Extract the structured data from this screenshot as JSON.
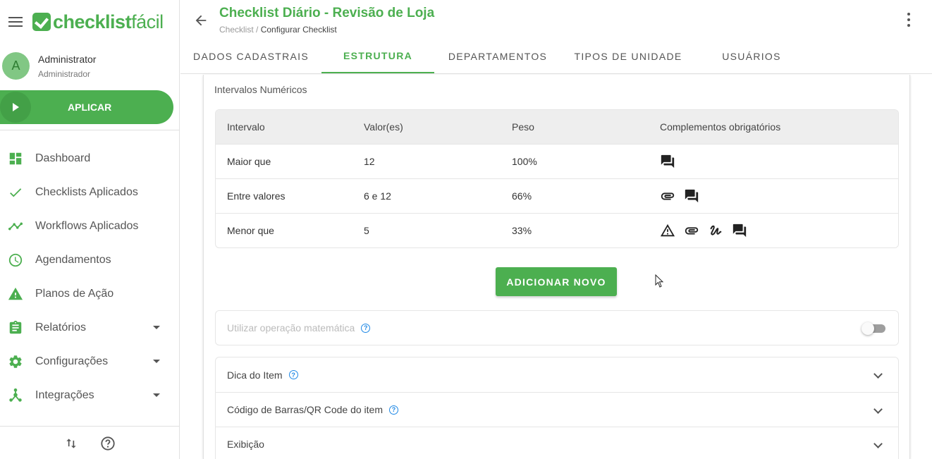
{
  "brand": {
    "logo_bold": "checklist",
    "logo_light": "fácil",
    "color": "#4caf50"
  },
  "user": {
    "initial": "A",
    "name": "Administrator",
    "role": "Administrador"
  },
  "apply_label": "APLICAR",
  "nav": [
    {
      "label": "Dashboard",
      "icon": "dashboard-icon"
    },
    {
      "label": "Checklists Aplicados",
      "icon": "check-icon"
    },
    {
      "label": "Workflows Aplicados",
      "icon": "trending-icon"
    },
    {
      "label": "Agendamentos",
      "icon": "clock-icon"
    },
    {
      "label": "Planos de Ação",
      "icon": "warning-icon"
    },
    {
      "label": "Relatórios",
      "icon": "clipboard-icon",
      "has_submenu": true
    },
    {
      "label": "Configurações",
      "icon": "gear-icon",
      "has_submenu": true
    },
    {
      "label": "Integrações",
      "icon": "hub-icon",
      "has_submenu": true
    }
  ],
  "header": {
    "title": "Checklist Diário - Revisão de Loja",
    "breadcrumb_root": "Checklist",
    "breadcrumb_sep": " / ",
    "breadcrumb_current": "Configurar Checklist"
  },
  "tabs": [
    {
      "label": "DADOS CADASTRAIS",
      "active": false
    },
    {
      "label": "ESTRUTURA",
      "active": true
    },
    {
      "label": "DEPARTAMENTOS",
      "active": false
    },
    {
      "label": "TIPOS DE UNIDADE",
      "active": false
    },
    {
      "label": "USUÁRIOS",
      "active": false
    }
  ],
  "section_title": "Intervalos Numéricos",
  "table": {
    "headers": [
      "Intervalo",
      "Valor(es)",
      "Peso",
      "Complementos obrigatórios"
    ],
    "rows": [
      {
        "interval": "Maior que",
        "values": "12",
        "weight": "100%",
        "complements": [
          "comment-icon"
        ]
      },
      {
        "interval": "Entre valores",
        "values": "6 e 12",
        "weight": "66%",
        "complements": [
          "attachment-icon",
          "comment-icon"
        ]
      },
      {
        "interval": "Menor que",
        "values": "5",
        "weight": "33%",
        "complements": [
          "warning-icon",
          "attachment-icon",
          "signature-icon",
          "comment-icon"
        ]
      }
    ]
  },
  "add_button_label": "ADICIONAR NOVO",
  "math_label": "Utilizar operação matemática",
  "math_enabled": false,
  "help_glyph": "?",
  "accordion": [
    {
      "label": "Dica do Item",
      "help": true
    },
    {
      "label": "Código de Barras/QR Code do item",
      "help": true
    },
    {
      "label": "Exibição",
      "help": false
    }
  ]
}
